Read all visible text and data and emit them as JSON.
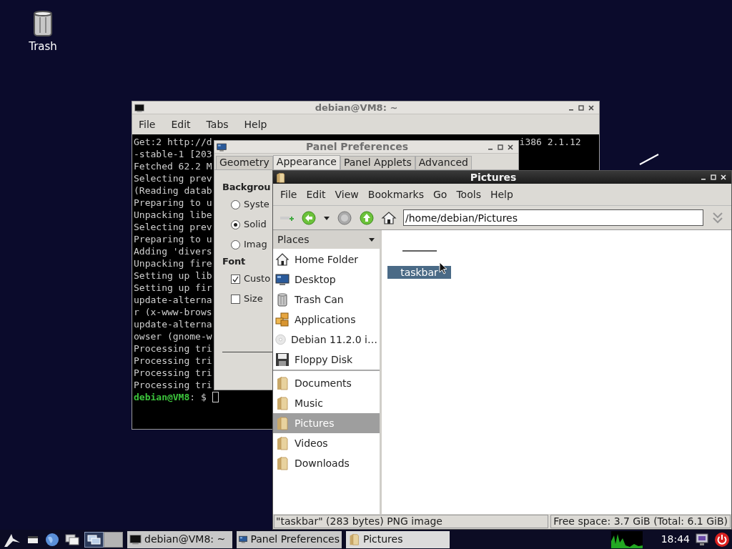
{
  "desktop": {
    "icons": [
      {
        "label": "Trash",
        "kind": "trash"
      }
    ]
  },
  "terminal": {
    "title": "debian@VM8: ~",
    "menu": [
      "File",
      "Edit",
      "Tabs",
      "Help"
    ],
    "lines": [
      "Get:2 http://d",
      "-stable-1 [203",
      "Fetched 62.2 M",
      "Selecting prev",
      "(Reading datab",
      "Preparing to u",
      "Unpacking libe",
      "Selecting prev",
      "Preparing to u",
      "Adding 'divers",
      "Unpacking fire",
      "Setting up lib",
      "Setting up fir",
      "update-alterna",
      "r (x-www-brows",
      "update-alterna",
      "owser (gnome-w",
      "Processing tri",
      "Processing tri",
      "Processing tri",
      "Processing tri"
    ],
    "first_line_tail": "i386 2.1.12",
    "prompt_user": "debian@VM8",
    "prompt_rest": ": $"
  },
  "panel_preferences": {
    "title": "Panel Preferences",
    "tabs": [
      {
        "label": "Geometry",
        "selected": false
      },
      {
        "label": "Appearance",
        "selected": true
      },
      {
        "label": "Panel Applets",
        "selected": false
      },
      {
        "label": "Advanced",
        "selected": false
      }
    ],
    "sections": [
      {
        "heading": "Backgrou",
        "options": [
          {
            "kind": "radio",
            "label": "Syste",
            "checked": false
          },
          {
            "kind": "radio",
            "label": "Solid",
            "checked": true
          },
          {
            "kind": "radio",
            "label": "Imag",
            "checked": false
          }
        ]
      },
      {
        "heading": "Font",
        "options": [
          {
            "kind": "checkbox",
            "label": "Custo",
            "checked": true
          },
          {
            "kind": "checkbox",
            "label": "Size",
            "checked": false
          }
        ]
      }
    ]
  },
  "file_manager": {
    "title": "Pictures",
    "menu": [
      "File",
      "Edit",
      "View",
      "Bookmarks",
      "Go",
      "Tools",
      "Help"
    ],
    "path": "/home/debian/Pictures",
    "places_heading": "Places",
    "place_groups": [
      [
        {
          "label": "Home Folder",
          "kind": "home",
          "selected": false
        },
        {
          "label": "Desktop",
          "kind": "desktop",
          "selected": false
        },
        {
          "label": "Trash Can",
          "kind": "trash",
          "selected": false
        },
        {
          "label": "Applications",
          "kind": "applications",
          "selected": false
        },
        {
          "label": "Debian 11.2.0 i…",
          "kind": "disc",
          "selected": false
        },
        {
          "label": "Floppy Disk",
          "kind": "floppy",
          "selected": false
        }
      ],
      [
        {
          "label": "Documents",
          "kind": "folder",
          "selected": false
        },
        {
          "label": "Music",
          "kind": "folder",
          "selected": false
        },
        {
          "label": "Pictures",
          "kind": "folder",
          "selected": true
        },
        {
          "label": "Videos",
          "kind": "folder",
          "selected": false
        },
        {
          "label": "Downloads",
          "kind": "folder",
          "selected": false
        }
      ]
    ],
    "files": [
      {
        "name": "taskbar",
        "selected": true
      }
    ],
    "status_left": "\"taskbar\" (283 bytes) PNG image",
    "status_right": "Free space: 3.7 GiB (Total: 6.1 GiB)"
  },
  "taskbar": {
    "workspaces": [
      {
        "selected": true
      },
      {
        "selected": false
      }
    ],
    "tasks": [
      {
        "label": "debian@VM8: ~",
        "kind": "terminal",
        "selected": false
      },
      {
        "label": "Panel Preferences",
        "kind": "desktop",
        "selected": false
      },
      {
        "label": "Pictures",
        "kind": "folder",
        "selected": true
      }
    ],
    "clock": "18:44"
  }
}
